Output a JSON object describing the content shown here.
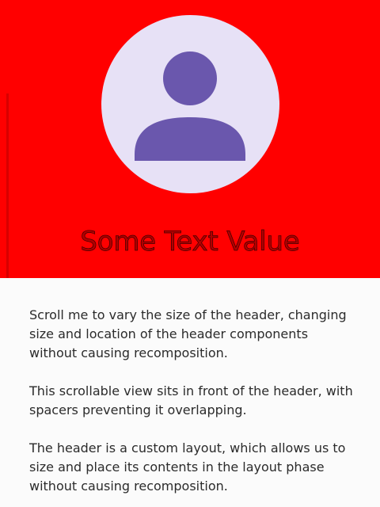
{
  "header": {
    "background_color": "#ff0000",
    "title": "Some Text Value",
    "avatar": {
      "icon": "person-icon",
      "background_color": "#e7e1f6",
      "icon_color": "#6a57ad"
    }
  },
  "content": {
    "paragraphs": [
      "Scroll me to vary the size of the header, changing size and location of the header components without causing recomposition.",
      "This scrollable view sits in front of the header, with spacers preventing it overlapping.",
      "The header is a custom layout, which allows us to size and place its contents in the layout phase without causing recomposition."
    ]
  }
}
